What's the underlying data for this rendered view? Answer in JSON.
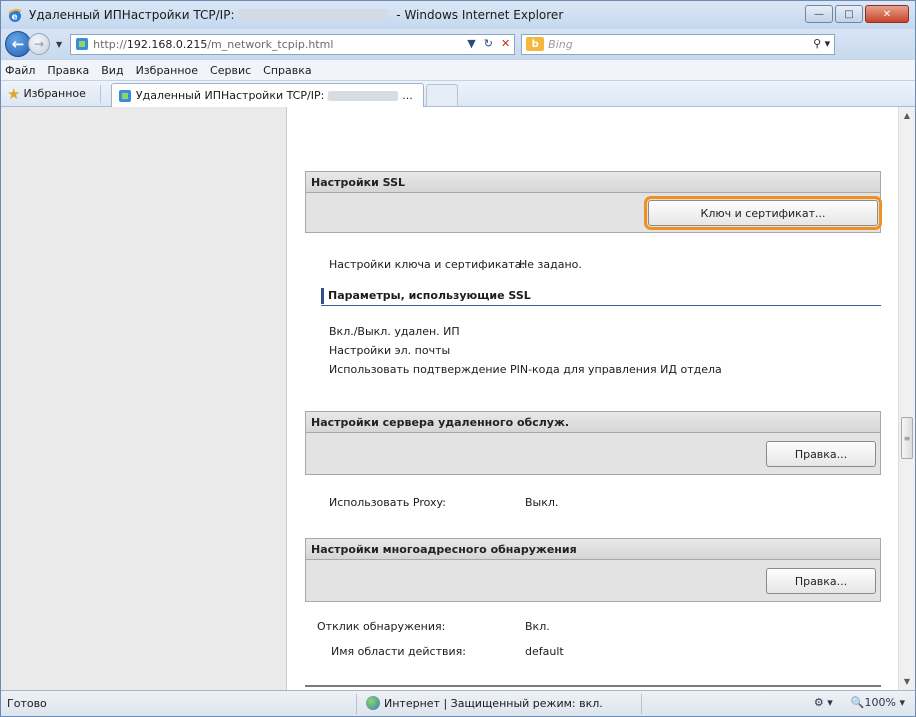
{
  "window": {
    "title_prefix": "Удаленный ИПНастройки TCP/IP:",
    "title_suffix": " - Windows Internet Explorer"
  },
  "address": {
    "url_prefix": "http://",
    "url_host": "192.168.0.215",
    "url_path": "/m_network_tcpip.html",
    "search_placeholder": "Bing"
  },
  "menu": [
    "Файл",
    "Правка",
    "Вид",
    "Избранное",
    "Сервис",
    "Справка"
  ],
  "favorites": {
    "label": "Избранное",
    "tab_title": "Удаленный ИПНастройки TCP/IP:",
    "tab_ellipsis": "..."
  },
  "ssl": {
    "heading": "Настройки SSL",
    "button": "Ключ и сертификат...",
    "key_label": "Настройки ключа и сертификата:",
    "key_value": "Не задано.",
    "params_heading": "Параметры, использующие SSL",
    "params": [
      "Вкл./Выкл. удален. ИП",
      "Настройки эл. почты",
      "Использовать подтверждение PIN-кода для управления ИД отдела"
    ]
  },
  "remote_service": {
    "heading": "Настройки сервера удаленного обслуж.",
    "button": "Правка...",
    "proxy_label": "Использовать Proxy:",
    "proxy_value": "Выкл."
  },
  "multicast": {
    "heading": "Настройки многоадресного обнаружения",
    "button": "Правка...",
    "response_label": "Отклик обнаружения:",
    "response_value": "Вкл.",
    "scope_label": "Имя области действия:",
    "scope_value": "default"
  },
  "status": {
    "ready": "Готово",
    "zone": "Интернет | Защищенный режим: вкл.",
    "zoom": "100%"
  }
}
